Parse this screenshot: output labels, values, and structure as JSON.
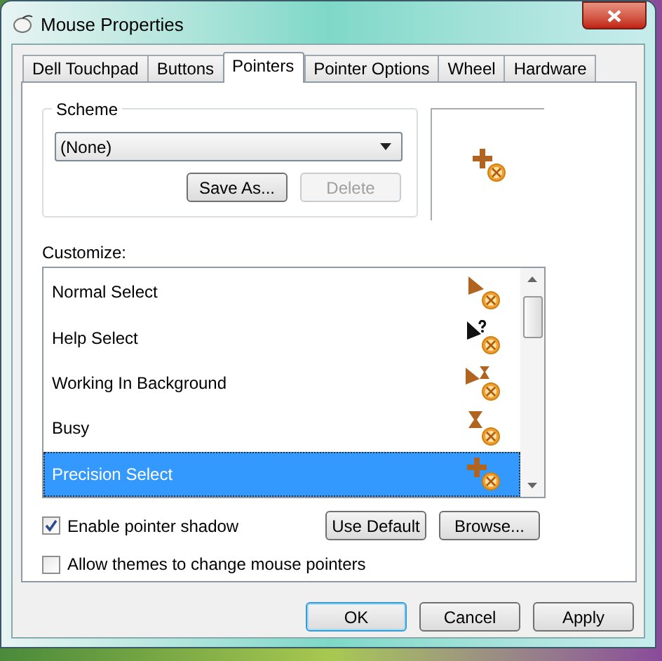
{
  "window": {
    "title": "Mouse Properties"
  },
  "tabs": [
    {
      "label": "Dell Touchpad",
      "selected": false
    },
    {
      "label": "Buttons",
      "selected": false
    },
    {
      "label": "Pointers",
      "selected": true
    },
    {
      "label": "Pointer Options",
      "selected": false
    },
    {
      "label": "Wheel",
      "selected": false
    },
    {
      "label": "Hardware",
      "selected": false
    }
  ],
  "scheme": {
    "label": "Scheme",
    "value": "(None)",
    "buttons": [
      {
        "label": "Save As...",
        "disabled": false
      },
      {
        "label": "Delete",
        "disabled": true
      }
    ]
  },
  "preview": {
    "kind": "cross"
  },
  "customize": {
    "label": "Customize:",
    "items": [
      {
        "label": "Normal Select",
        "kind": "arrow",
        "selected": false
      },
      {
        "label": "Help Select",
        "kind": "help",
        "selected": false
      },
      {
        "label": "Working In Background",
        "kind": "working",
        "selected": false
      },
      {
        "label": "Busy",
        "kind": "busy",
        "selected": false
      },
      {
        "label": "Precision Select",
        "kind": "cross",
        "selected": true
      }
    ]
  },
  "options": [
    {
      "label": "Enable pointer shadow",
      "checked": true
    },
    {
      "label": "Allow themes to change mouse pointers",
      "checked": false
    }
  ],
  "list_buttons": [
    "Use Default",
    "Browse..."
  ],
  "dialog_buttons": [
    {
      "label": "OK",
      "default": true
    },
    {
      "label": "Cancel",
      "default": false
    },
    {
      "label": "Apply",
      "default": false
    }
  ]
}
